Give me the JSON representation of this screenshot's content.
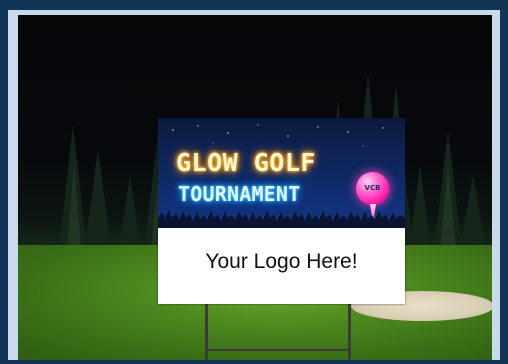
{
  "sign": {
    "headline_line1": "GLOW GOLF",
    "headline_line2": "TOURNAMENT",
    "ball_logo": "VCB",
    "logo_placeholder": "Your Logo Here!"
  },
  "colors": {
    "sign_top": "#0f2a66",
    "glow_orange": "#ff9a1a",
    "glow_blue": "#19a8ff",
    "ball_pink": "#ff1aa6",
    "grass": "#4d8a1f"
  }
}
